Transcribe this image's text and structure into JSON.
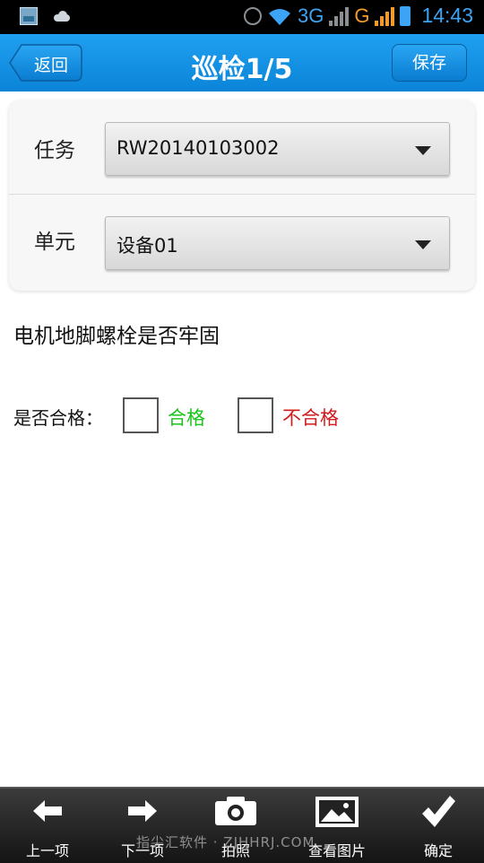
{
  "status_bar": {
    "network_1": "3G",
    "network_2": "G",
    "time": "14:43"
  },
  "header": {
    "back_label": "返回",
    "title": "巡检1/5",
    "save_label": "保存"
  },
  "form": {
    "task_label": "任务",
    "task_value": "RW20140103002",
    "unit_label": "单元",
    "unit_value": "设备01"
  },
  "inspection": {
    "question": "电机地脚螺栓是否牢固",
    "qualified_label": "是否合格：",
    "pass_label": "合格",
    "fail_label": "不合格",
    "pass_color": "#19c41a",
    "fail_color": "#d11a1a"
  },
  "toolbar": {
    "prev_label": "上一项",
    "next_label": "下一项",
    "photo_label": "拍照",
    "view_photos_label": "查看图片",
    "confirm_label": "确定"
  },
  "watermark": "指尖汇软件 · ZJHHRJ.COM",
  "colors": {
    "accent": "#0b84d8",
    "status_text": "#3da4f5"
  }
}
